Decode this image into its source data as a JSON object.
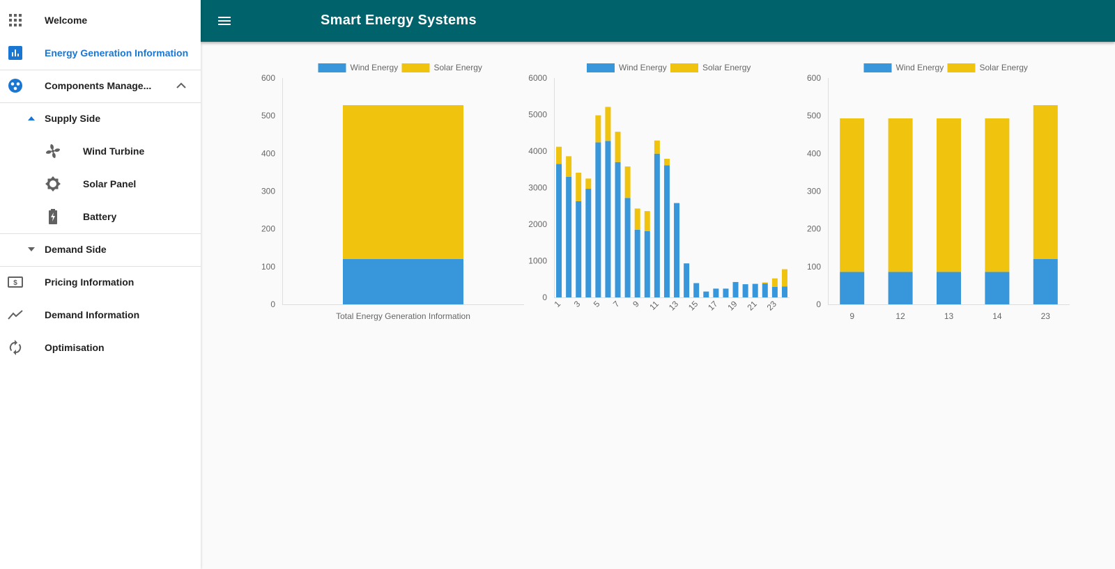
{
  "app": {
    "title": "Smart Energy Systems"
  },
  "sidebar": {
    "items": [
      {
        "label": "Welcome",
        "icon": "apps-grid-icon"
      },
      {
        "label": "Energy Generation Information",
        "icon": "bar-chart-icon",
        "active": true
      },
      {
        "label": "Components Manage...",
        "icon": "components-icon"
      },
      {
        "label": "Supply Side",
        "icon": "caret-up-icon"
      },
      {
        "label": "Wind Turbine",
        "icon": "fan-icon"
      },
      {
        "label": "Solar Panel",
        "icon": "sun-icon"
      },
      {
        "label": "Battery",
        "icon": "battery-icon"
      },
      {
        "label": "Demand Side",
        "icon": "caret-down-icon"
      },
      {
        "label": "Pricing Information",
        "icon": "money-icon"
      },
      {
        "label": "Demand Information",
        "icon": "trend-line-icon"
      },
      {
        "label": "Optimisation",
        "icon": "refresh-icon"
      }
    ]
  },
  "colors": {
    "wind": "#3897db",
    "solar": "#f0c30f",
    "appbar": "#00626a",
    "active": "#1976d2"
  },
  "chart_data": [
    {
      "type": "bar",
      "stacked": true,
      "legend_position": "top",
      "categories": [],
      "xlabel": "Total Energy Generation Information",
      "ylim": [
        0,
        600
      ],
      "yticks": [
        0,
        100,
        200,
        300,
        400,
        500,
        600
      ],
      "series": [
        {
          "name": "Wind Energy",
          "values": [
            120
          ]
        },
        {
          "name": "Solar Energy",
          "values": [
            408
          ]
        }
      ]
    },
    {
      "type": "bar",
      "stacked": true,
      "legend_position": "top",
      "categories": [
        "1",
        "2",
        "3",
        "4",
        "5",
        "6",
        "7",
        "8",
        "9",
        "10",
        "11",
        "12",
        "13",
        "14",
        "15",
        "16",
        "17",
        "18",
        "19",
        "20",
        "21",
        "22",
        "23",
        "24"
      ],
      "tick_labels": [
        "1",
        "3",
        "5",
        "7",
        "9",
        "11",
        "13",
        "15",
        "17",
        "19",
        "21",
        "23"
      ],
      "ylim": [
        0,
        6000
      ],
      "yticks": [
        0,
        1000,
        2000,
        3000,
        4000,
        5000,
        6000
      ],
      "series": [
        {
          "name": "Wind Energy",
          "values": [
            3650,
            3300,
            2630,
            2970,
            4240,
            4280,
            3700,
            2720,
            1850,
            1810,
            3930,
            3610,
            2580,
            930,
            390,
            160,
            240,
            240,
            420,
            360,
            370,
            380,
            290,
            300
          ]
        },
        {
          "name": "Solar Energy",
          "values": [
            470,
            560,
            780,
            280,
            740,
            930,
            830,
            860,
            580,
            550,
            360,
            180,
            0,
            0,
            0,
            0,
            0,
            0,
            0,
            0,
            0,
            30,
            230,
            470
          ]
        }
      ]
    },
    {
      "type": "bar",
      "stacked": true,
      "legend_position": "top",
      "categories": [
        "9",
        "12",
        "13",
        "14",
        "23"
      ],
      "ylim": [
        0,
        600
      ],
      "yticks": [
        0,
        100,
        200,
        300,
        400,
        500,
        600
      ],
      "series": [
        {
          "name": "Wind Energy",
          "values": [
            86,
            86,
            86,
            86,
            120
          ]
        },
        {
          "name": "Solar Energy",
          "values": [
            407,
            407,
            407,
            407,
            408
          ]
        }
      ]
    }
  ]
}
